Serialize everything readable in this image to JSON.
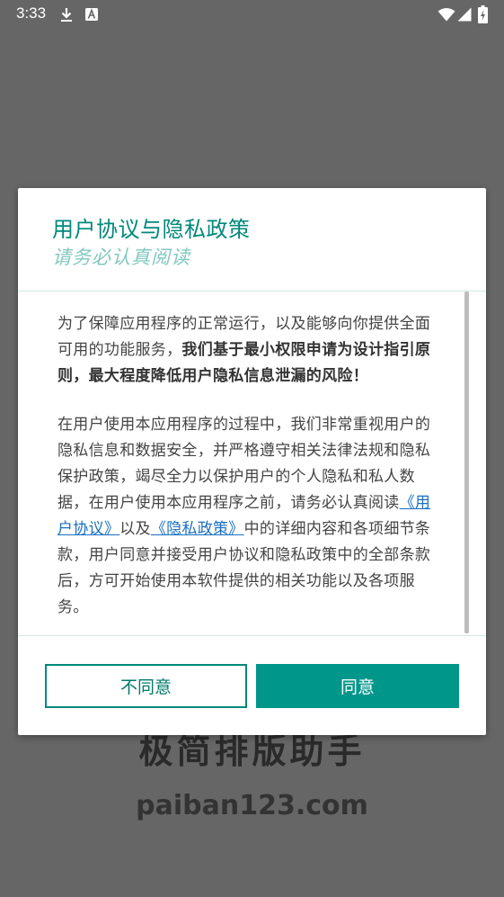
{
  "status_bar": {
    "time": "3:33",
    "icons": [
      "download-icon",
      "font-a-icon",
      "wifi-icon",
      "signal-icon",
      "battery-charging-icon"
    ]
  },
  "background": {
    "app_name": "极简排版助手",
    "url": "paiban123.com"
  },
  "dialog": {
    "title": "用户协议与隐私政策",
    "subtitle": "请务必认真阅读",
    "paragraph1": {
      "normal": "为了保障应用程序的正常运行，以及能够向你提供全面可用的功能服务，",
      "bold": "我们基于最小权限申请为设计指引原则，最大程度降低用户隐私信息泄漏的风险！"
    },
    "paragraph2": {
      "part1": "在用户使用本应用程序的过程中，我们非常重视用户的隐私信息和数据安全，并严格遵守相关法律法规和隐私保护政策，竭尽全力以保护用户的个人隐私和私人数据，在用户使用本应用程序之前，请务必认真阅读",
      "link_user_agreement": "《用户协议》",
      "part2": "以及",
      "link_privacy_policy": "《隐私政策》",
      "part3": "中的详细内容和各项细节条款，用户同意并接受用户协议和隐私政策中的全部条款后，方可开始使用本软件提供的相关功能以及各项服务。"
    },
    "buttons": {
      "disagree": "不同意",
      "agree": "同意"
    },
    "colors": {
      "accent": "#00897b",
      "agree_button": "#00968a",
      "link": "#1a6fbf"
    }
  }
}
